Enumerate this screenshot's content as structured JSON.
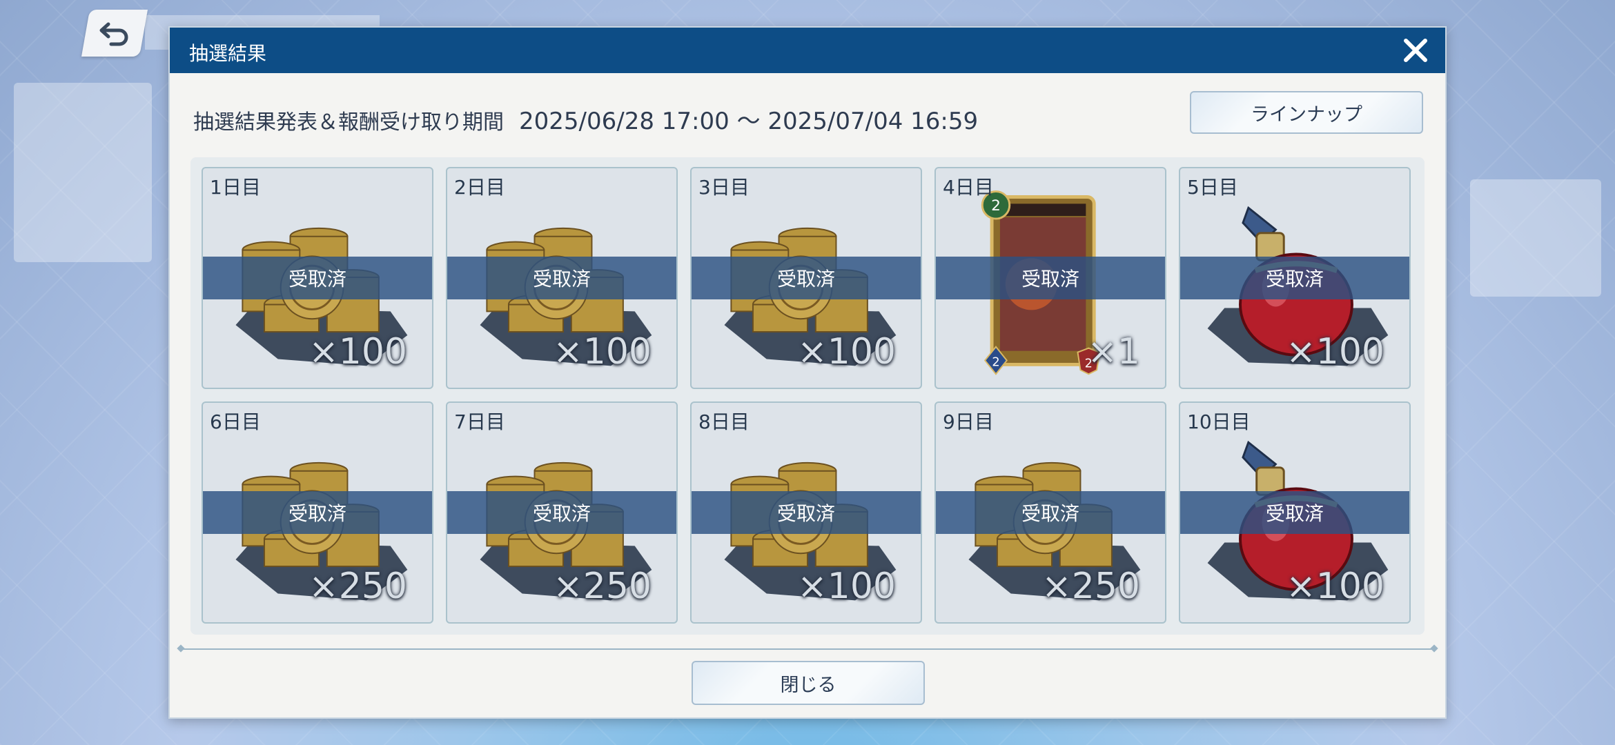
{
  "dialog": {
    "title": "抽選結果",
    "period_label": "抽選結果発表＆報酬受け取り期間",
    "period_range": "2025/06/28 17:00 ～ 2025/07/04 16:59",
    "lineup_button": "ラインナップ",
    "close_button": "閉じる"
  },
  "rewards": [
    {
      "day": "1日目",
      "status": "受取済",
      "qty": "×100",
      "item_icon": "coins-icon"
    },
    {
      "day": "2日目",
      "status": "受取済",
      "qty": "×100",
      "item_icon": "coins-icon"
    },
    {
      "day": "3日目",
      "status": "受取済",
      "qty": "×100",
      "item_icon": "coins-icon"
    },
    {
      "day": "4日目",
      "status": "受取済",
      "qty": "×1",
      "item_icon": "card-icon"
    },
    {
      "day": "5日目",
      "status": "受取済",
      "qty": "×100",
      "item_icon": "potion-icon"
    },
    {
      "day": "6日目",
      "status": "受取済",
      "qty": "×250",
      "item_icon": "coins-icon"
    },
    {
      "day": "7日目",
      "status": "受取済",
      "qty": "×250",
      "item_icon": "coins-icon"
    },
    {
      "day": "8日目",
      "status": "受取済",
      "qty": "×100",
      "item_icon": "coins-icon"
    },
    {
      "day": "9日目",
      "status": "受取済",
      "qty": "×250",
      "item_icon": "coins-icon"
    },
    {
      "day": "10日目",
      "status": "受取済",
      "qty": "×100",
      "item_icon": "potion-icon"
    }
  ],
  "colors": {
    "header": "#0d4d86",
    "band": "#2c5282"
  }
}
